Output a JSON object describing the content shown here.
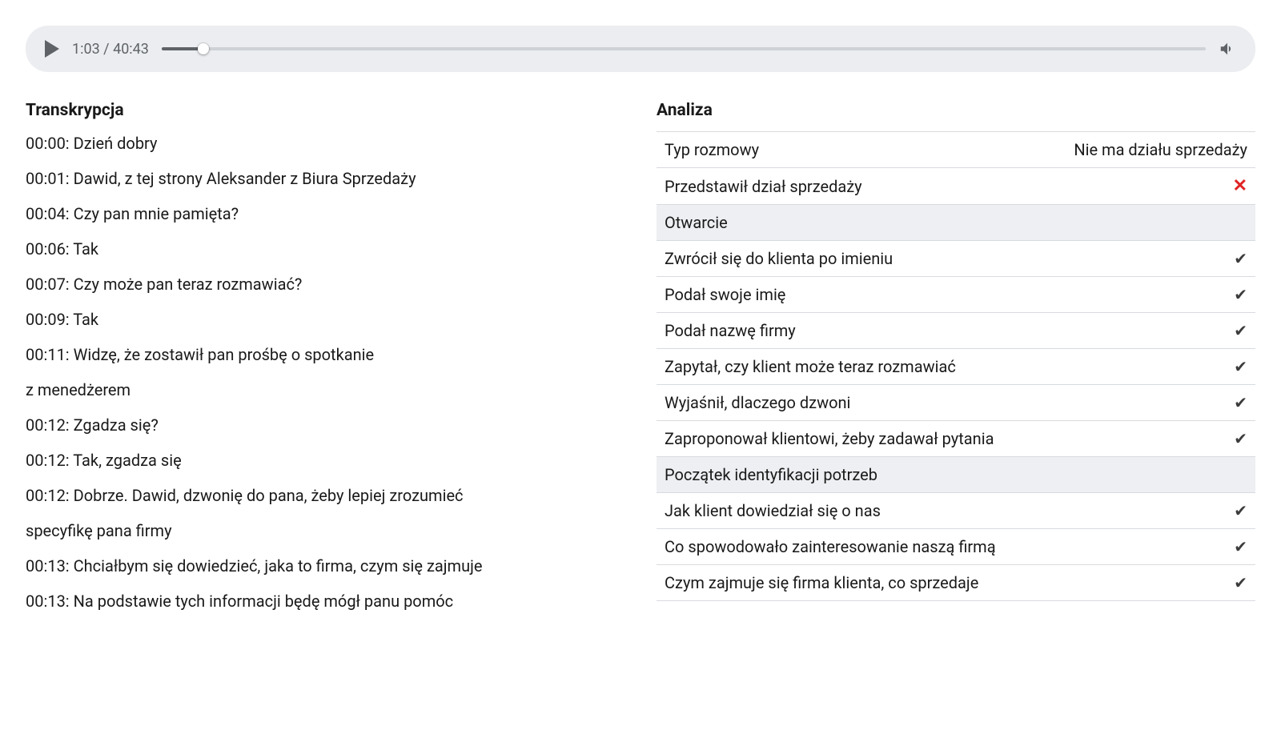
{
  "player": {
    "current_time": "1:03",
    "total_time": "40:43",
    "progress_pct": "4%"
  },
  "transcript": {
    "title": "Transkrypcja",
    "lines": [
      "00:00: Dzień dobry",
      "00:01: Dawid, z tej strony Aleksander z Biura Sprzedaży",
      "00:04: Czy pan mnie pamięta?",
      "00:06: Tak",
      "00:07: Czy może pan teraz rozmawiać?",
      "00:09: Tak",
      "00:11: Widzę, że zostawił pan prośbę o spotkanie",
      "z menedżerem",
      "00:12: Zgadza się?",
      "00:12: Tak, zgadza się",
      "00:12: Dobrze. Dawid, dzwonię do pana, żeby lepiej zrozumieć",
      "specyfikę pana firmy",
      "00:13: Chciałbym się dowiedzieć, jaka to firma, czym się zajmuje",
      "00:13: Na podstawie tych informacji będę mógł panu pomóc"
    ]
  },
  "analysis": {
    "title": "Analiza",
    "rows": [
      {
        "type": "item",
        "label": "Typ rozmowy",
        "value_kind": "text",
        "value": "Nie ma działu sprzedaży"
      },
      {
        "type": "item",
        "label": "Przedstawił dział sprzedaży",
        "value_kind": "cross",
        "value": "✕"
      },
      {
        "type": "section",
        "label": "Otwarcie"
      },
      {
        "type": "item",
        "label": "Zwrócił się do klienta po imieniu",
        "value_kind": "check",
        "value": "✔"
      },
      {
        "type": "item",
        "label": "Podał swoje imię",
        "value_kind": "check",
        "value": "✔"
      },
      {
        "type": "item",
        "label": "Podał nazwę firmy",
        "value_kind": "check",
        "value": "✔"
      },
      {
        "type": "item",
        "label": "Zapytał, czy klient może teraz rozmawiać",
        "value_kind": "check",
        "value": "✔"
      },
      {
        "type": "item",
        "label": "Wyjaśnił, dlaczego dzwoni",
        "value_kind": "check",
        "value": "✔"
      },
      {
        "type": "item",
        "label": "Zaproponował klientowi, żeby zadawał pytania",
        "value_kind": "check",
        "value": "✔"
      },
      {
        "type": "section",
        "label": "Początek identyfikacji potrzeb"
      },
      {
        "type": "item",
        "label": "Jak klient dowiedział się o nas",
        "value_kind": "check",
        "value": "✔"
      },
      {
        "type": "item",
        "label": "Co spowodowało zainteresowanie naszą firmą",
        "value_kind": "check",
        "value": "✔"
      },
      {
        "type": "item",
        "label": "Czym zajmuje się firma klienta, co sprzedaje",
        "value_kind": "check",
        "value": "✔"
      }
    ]
  }
}
